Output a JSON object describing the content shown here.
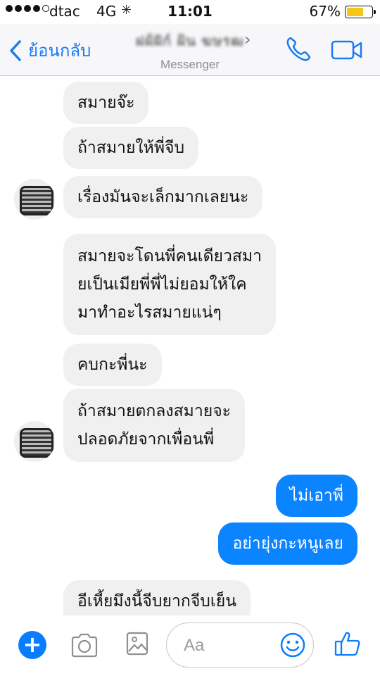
{
  "status_bar": {
    "carrier": "dtac",
    "network": "4G",
    "time": "11:01",
    "battery_percent": "67%",
    "battery_level": 0.67,
    "signal_bars_filled": 4,
    "signal_bars_total": 5
  },
  "nav": {
    "back_label": "ย้อนกลับ",
    "contact_name": "ฝฝ์ฝัก์ ฝ้น ฆษรฒ",
    "chevron": "›",
    "subtitle": "Messenger",
    "accent_color": "#1a7cf2"
  },
  "messages": [
    {
      "direction": "incoming",
      "text": "สมายจ๊ะ"
    },
    {
      "direction": "incoming",
      "text": "ถ้าสมายให้พี่จีบ"
    },
    {
      "direction": "incoming",
      "text": "เรื่องมันจะเล็กมากเลยนะ"
    },
    {
      "direction": "incoming",
      "lines": [
        "สมายจะโดนพี่คนเดียวสมา",
        "ยเป็นเมียพี่พี่ไม่ยอมให้ใค",
        "มาทำอะไรสมายแน่ๆ"
      ]
    },
    {
      "direction": "incoming",
      "text": "คบกะพี่นะ"
    },
    {
      "direction": "incoming",
      "lines": [
        "ถ้าสมายตกลงสมายจะ",
        "ปลอดภัยจากเพื่อนพี่"
      ]
    },
    {
      "direction": "outgoing",
      "text": "ไม่เอาพี่"
    },
    {
      "direction": "outgoing",
      "text": "อย่ายุ่งกะหนูเลย"
    },
    {
      "direction": "incoming",
      "text": "อีเหี้ยมึงนี้จีบยากจีบเย็น"
    }
  ],
  "composer": {
    "placeholder": "Aa",
    "plus_symbol": "+",
    "icons": [
      "plus-icon",
      "camera-icon",
      "gallery-icon",
      "smile-icon",
      "thumbs-up-icon"
    ]
  },
  "colors": {
    "incoming_bubble": "#f1f0f0",
    "outgoing_bubble": "#0a84ff",
    "messenger_blue": "#0a7cff"
  }
}
